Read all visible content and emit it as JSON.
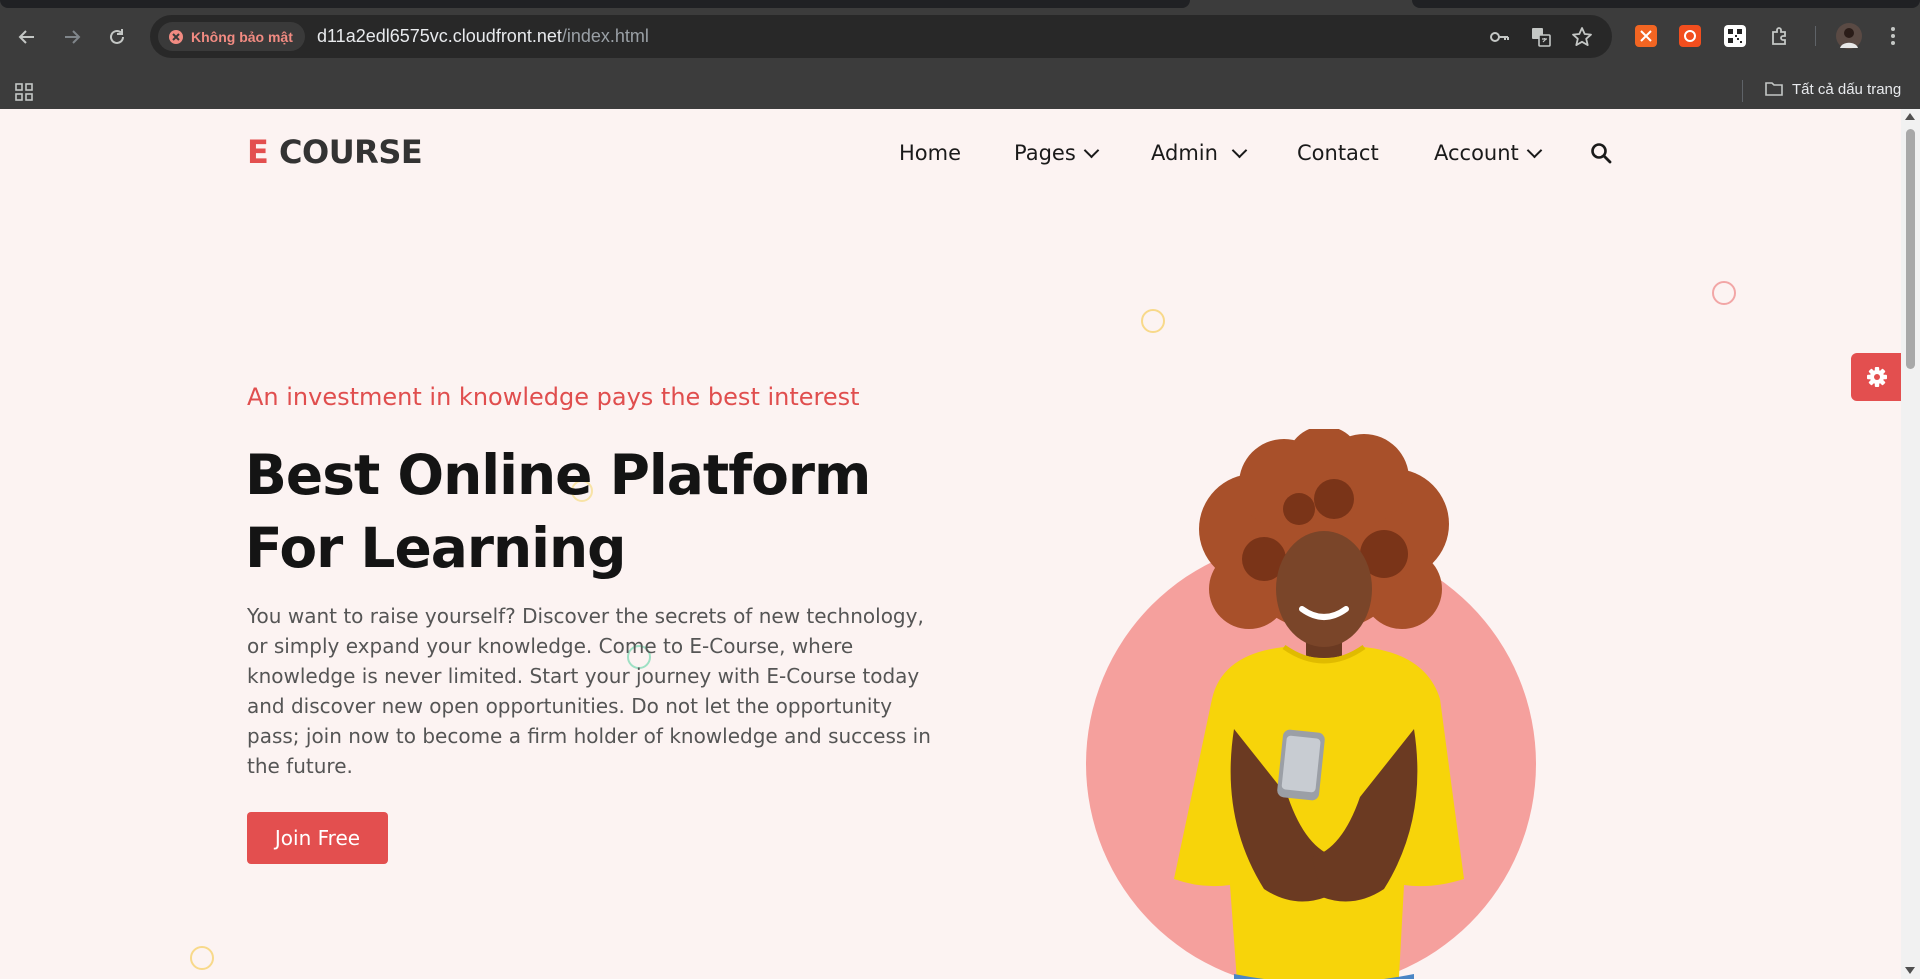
{
  "browser": {
    "security_label": "Không bảo mật",
    "url_host": "d11a2edl6575vc.cloudfront.net",
    "url_path": "/index.html",
    "bookmarks_all_label": "Tất cả dấu trang"
  },
  "site": {
    "logo_accent": "E",
    "logo_text": "COURSE",
    "nav": {
      "home": "Home",
      "pages": "Pages",
      "admin": "Admin",
      "contact": "Contact",
      "account": "Account"
    },
    "hero": {
      "tagline": "An investment in knowledge pays the best interest",
      "title_line1": "Best Online Platform",
      "title_line2": "For Learning",
      "description": "You want to raise yourself? Discover the secrets of new technology, or simply expand your knowledge. Come to E-Course, where knowledge is never limited. Start your journey with E-Course today and discover new open opportunities. Do not let the opportunity pass; join now to become a firm holder of knowledge and success in the future.",
      "cta_label": "Join Free"
    }
  },
  "colors": {
    "accent": "#e34f4f",
    "page_bg": "#fcf3f2",
    "hero_circle": "#f5a09d"
  },
  "icons": {
    "back": "arrow-left-icon",
    "forward": "arrow-right-icon",
    "reload": "reload-icon",
    "search": "search-icon",
    "settings": "gear-icon"
  }
}
